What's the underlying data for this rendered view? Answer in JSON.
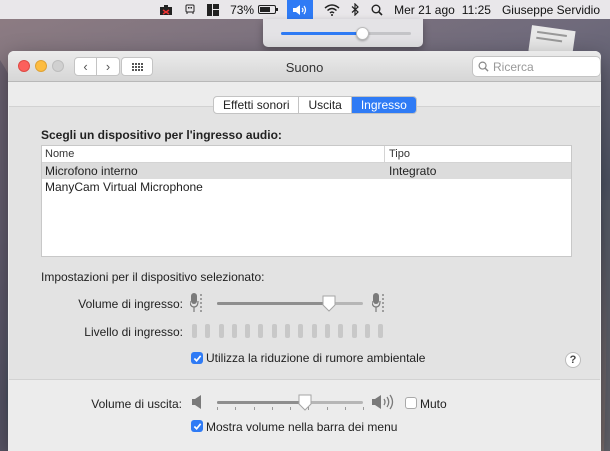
{
  "menubar": {
    "battery_percent": "73%",
    "battery_level": 0.73,
    "date": "Mer 21 ago",
    "time": "11:25",
    "user": "Giuseppe Servidio"
  },
  "volume_popover": {
    "level": 0.62
  },
  "window": {
    "title": "Suono",
    "search_placeholder": "Ricerca"
  },
  "tabs": [
    {
      "label": "Effetti sonori",
      "active": false
    },
    {
      "label": "Uscita",
      "active": false
    },
    {
      "label": "Ingresso",
      "active": true
    }
  ],
  "input": {
    "section_title": "Scegli un dispositivo per l'ingresso audio:",
    "columns": {
      "name": "Nome",
      "type": "Tipo"
    },
    "devices": [
      {
        "name": "Microfono interno",
        "type": "Integrato",
        "selected": true
      },
      {
        "name": "ManyCam Virtual Microphone",
        "type": "",
        "selected": false
      }
    ],
    "settings_label": "Impostazioni per il dispositivo selezionato:",
    "volume_label": "Volume di ingresso:",
    "volume_level": 0.77,
    "level_label": "Livello di ingresso:",
    "level_bar_count": 15,
    "level_active": 0,
    "noise_reduction_label": "Utilizza la riduzione di rumore ambientale",
    "noise_reduction_checked": true
  },
  "output": {
    "volume_label": "Volume di uscita:",
    "volume_level": 0.6,
    "mute_label": "Muto",
    "mute_checked": false,
    "show_in_menubar_label": "Mostra volume nella barra dei menu",
    "show_in_menubar_checked": true
  },
  "help_label": "?",
  "colors": {
    "accent": "#2f7bf5"
  }
}
